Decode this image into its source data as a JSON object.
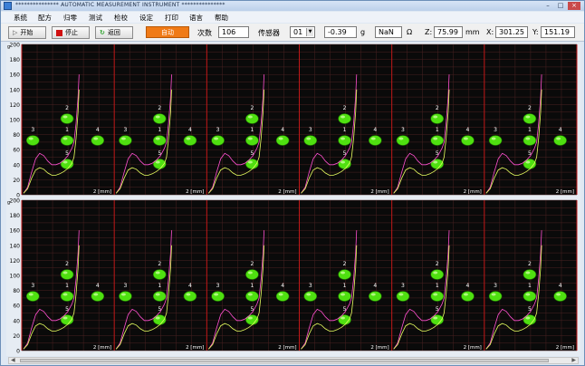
{
  "window": {
    "title": "***************  AUTOMATIC MEASUREMENT INSTRUMENT  ***************"
  },
  "menu": [
    "系统",
    "配方",
    "归零",
    "测试",
    "检校",
    "设定",
    "打印",
    "语言",
    "帮助"
  ],
  "toolbar": {
    "start_label": "开始",
    "stop_label": "停止",
    "back_label": "返回",
    "auto_label": "自动",
    "count_label": "次数",
    "count_value": "106",
    "sensor_label": "传感器",
    "sensor_value": "01",
    "force_value": "-0.39",
    "force_unit": "g",
    "resistance_value": "NaN",
    "resistance_unit": "Ω",
    "z_label": "Z:",
    "z_value": "75.99",
    "z_unit": "mm",
    "x_label": "X:",
    "x_value": "301.25",
    "y_label": "Y:",
    "y_value": "151.19"
  },
  "colors": {
    "chart_bg": "#0a0a0a",
    "grid_minor": "#4a2222",
    "separator": "#c01818",
    "key_green": "#4fe010",
    "curve_pink": "#ff50d0",
    "curve_yellow": "#e8ff60"
  },
  "chart_data": {
    "type": "line",
    "panels_per_row": 6,
    "rows": 2,
    "y_ticks": [
      0,
      20,
      40,
      60,
      80,
      100,
      120,
      140,
      160,
      180,
      200
    ],
    "ylim": [
      0,
      200
    ],
    "ylabel": "g",
    "xlabel": "2 [mm]",
    "key_labels": [
      "1",
      "2",
      "3",
      "4",
      "5"
    ],
    "panel_curves": {
      "pink": [
        [
          0,
          2
        ],
        [
          4,
          10
        ],
        [
          8,
          30
        ],
        [
          12,
          48
        ],
        [
          16,
          55
        ],
        [
          20,
          52
        ],
        [
          24,
          45
        ],
        [
          28,
          40
        ],
        [
          32,
          40
        ],
        [
          36,
          42
        ],
        [
          40,
          46
        ],
        [
          44,
          52
        ],
        [
          48,
          62
        ],
        [
          50,
          70
        ],
        [
          52,
          95
        ],
        [
          54,
          130
        ],
        [
          55,
          160
        ]
      ],
      "yellow": [
        [
          0,
          2
        ],
        [
          4,
          8
        ],
        [
          8,
          22
        ],
        [
          12,
          33
        ],
        [
          16,
          36
        ],
        [
          20,
          34
        ],
        [
          24,
          29
        ],
        [
          28,
          26
        ],
        [
          32,
          26
        ],
        [
          36,
          28
        ],
        [
          40,
          31
        ],
        [
          44,
          35
        ],
        [
          48,
          42
        ],
        [
          50,
          50
        ],
        [
          52,
          75
        ],
        [
          54,
          110
        ],
        [
          55,
          140
        ]
      ]
    }
  }
}
